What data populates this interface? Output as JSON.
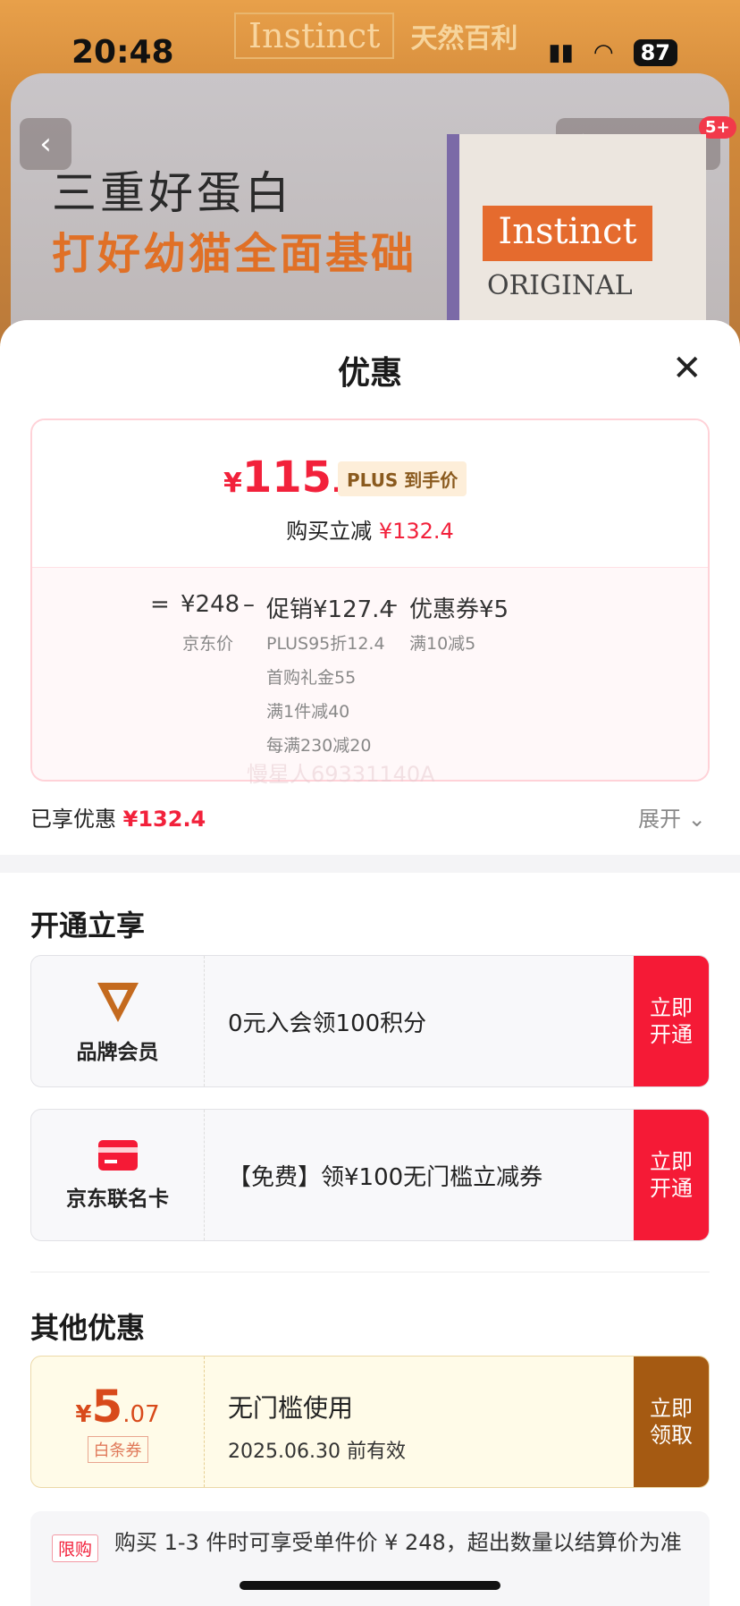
{
  "status": {
    "time": "20:48",
    "battery": "87"
  },
  "brand": {
    "en": "Instinct",
    "cn": "天然百利"
  },
  "banner": {
    "line1": "三重好蛋白",
    "line2": "打好幼猫全面基础",
    "bag_brand": "Instinct",
    "bag_label": "ORIGINAL",
    "badge": "5+"
  },
  "sheet": {
    "title": "优惠"
  },
  "price": {
    "currency": "¥",
    "int": "115",
    "dec": ".6",
    "plus_label": "PLUS 到手价",
    "reduce_label": "购买立减",
    "reduce_value": "¥132.4"
  },
  "calc": {
    "eq": "=",
    "jd_price": "¥248",
    "jd_label": "京东价",
    "minus1": "–",
    "promo": "促销¥127.4",
    "promo_items": [
      "PLUS95折12.4",
      "首购礼金55",
      "满1件减40",
      "每满230减20"
    ],
    "minus2": "–",
    "coupon": "优惠券¥5",
    "coupon_item": "满10减5"
  },
  "watermark": "慢星人69331140A",
  "summary": {
    "label": "已享优惠",
    "value": "¥132.4",
    "expand": "展开"
  },
  "open": {
    "title": "开通立享",
    "items": [
      {
        "name": "品牌会员",
        "text": "0元入会领100积分",
        "btn1": "立即",
        "btn2": "开通"
      },
      {
        "name": "京东联名卡",
        "text": "【免费】领¥100无门槛立减券",
        "btn1": "立即",
        "btn2": "开通"
      }
    ]
  },
  "other": {
    "title": "其他优惠",
    "coupon": {
      "currency": "¥",
      "int": "5",
      "dec": ".07",
      "tag": "白条券",
      "title": "无门槛使用",
      "date": "2025.06.30 前有效",
      "btn1": "立即",
      "btn2": "领取"
    }
  },
  "note": {
    "tag": "限购",
    "text": "购买 1-3 件时可享受单件价 ¥ 248，超出数量以结算价为准"
  },
  "colors": {
    "accent": "#f2213b",
    "brown": "#a55a12"
  }
}
